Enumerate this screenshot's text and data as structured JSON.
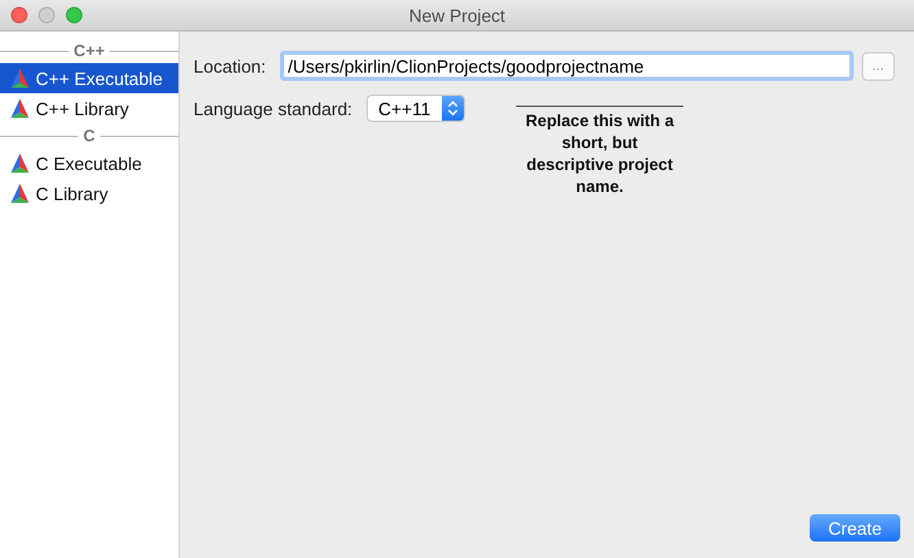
{
  "window": {
    "title": "New Project"
  },
  "sidebar": {
    "groups": [
      {
        "header": "C++",
        "items": [
          {
            "label": "C++ Executable",
            "selected": true
          },
          {
            "label": "C++ Library",
            "selected": false
          }
        ]
      },
      {
        "header": "C",
        "items": [
          {
            "label": "C Executable",
            "selected": false
          },
          {
            "label": "C Library",
            "selected": false
          }
        ]
      }
    ]
  },
  "form": {
    "location": {
      "label": "Location:",
      "value": "/Users/pkirlin/ClionProjects/goodprojectname",
      "browse": "..."
    },
    "language": {
      "label": "Language standard:",
      "value": "C++11"
    }
  },
  "annotation": "Replace this with a short, but descriptive project name.",
  "buttons": [
    "Create"
  ]
}
